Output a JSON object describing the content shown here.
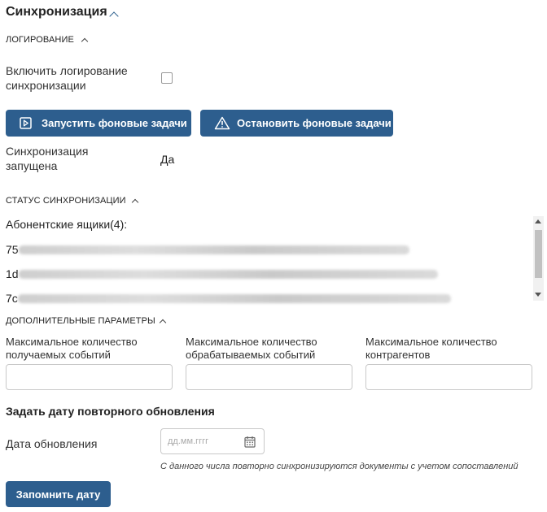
{
  "section": {
    "title": "Синхронизация"
  },
  "logging": {
    "title": "ЛОГИРОВАНИЕ",
    "enable_label": "Включить логирование синхронизации",
    "checked": false
  },
  "buttons": {
    "start": "Запустить фоновые задачи",
    "stop": "Остановить фоновые задачи"
  },
  "sync_state": {
    "label": "Синхронизация запущена",
    "value": "Да"
  },
  "status": {
    "title": "СТАТУС СИНХРОНИЗАЦИИ",
    "mailboxes_title": "Абонентские ящики(4):",
    "items": [
      "75",
      "1d",
      "7c"
    ]
  },
  "extra": {
    "title": "ДОПОЛНИТЕЛЬНЫЕ ПАРАМЕТРЫ",
    "fields": [
      {
        "label": "Максимальное количество получаемых событий",
        "value": ""
      },
      {
        "label": "Максимальное количество обрабатываемых событий",
        "value": ""
      },
      {
        "label": "Максимальное количество контрагентов",
        "value": ""
      }
    ]
  },
  "reupdate": {
    "title": "Задать дату повторного обновления",
    "date_label": "Дата обновления",
    "date_placeholder": "дд.мм.гггг",
    "hint": "С данного числа повторно синхронизируются документы с учетом сопоставлений",
    "save_button": "Запомнить дату"
  }
}
